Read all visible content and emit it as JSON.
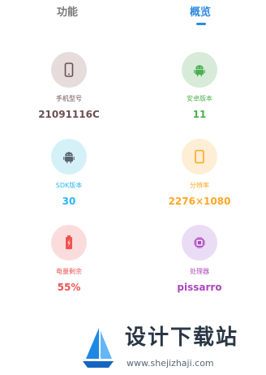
{
  "tabs": [
    {
      "label": "功能",
      "active": false
    },
    {
      "label": "概览",
      "active": true
    }
  ],
  "accent_color": "#2f8be0",
  "overview": {
    "items": [
      {
        "label": "手机型号",
        "value": "21091116C",
        "icon": "phone-icon",
        "color": "#6b5050"
      },
      {
        "label": "安卓版本",
        "value": "11",
        "icon": "android-icon",
        "color": "#4caf50"
      },
      {
        "label": "SDK版本",
        "value": "30",
        "icon": "sdk-icon",
        "color": "#29b6f6"
      },
      {
        "label": "分辨率",
        "value": "2276×1080",
        "icon": "screen-icon",
        "color": "#ffa726"
      },
      {
        "label": "电量剩余",
        "value": "55%",
        "icon": "battery-icon",
        "color": "#ef5350"
      },
      {
        "label": "处理器",
        "value": "pissarro",
        "icon": "chip-icon",
        "color": "#ab47bc"
      }
    ]
  },
  "watermark": {
    "title": "设计下载站",
    "url": "www.shejizhaji.com"
  }
}
